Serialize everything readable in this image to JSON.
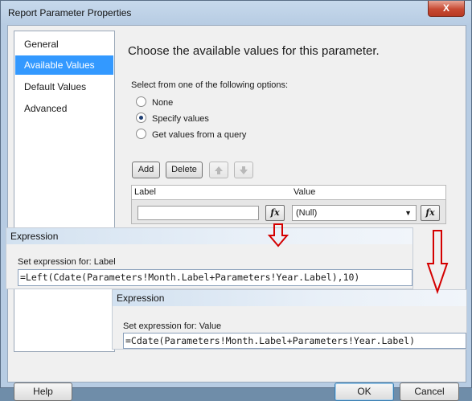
{
  "window": {
    "title": "Report Parameter Properties",
    "close_symbol": "X"
  },
  "nav": {
    "items": [
      "General",
      "Available Values",
      "Default Values",
      "Advanced"
    ],
    "active_index": 1
  },
  "content": {
    "heading": "Choose the available values for this parameter.",
    "options_label": "Select from one of the following options:",
    "options": [
      {
        "label": "None",
        "checked": false
      },
      {
        "label": "Specify values",
        "checked": true
      },
      {
        "label": "Get values from a query",
        "checked": false
      }
    ],
    "buttons": {
      "add": "Add",
      "delete": "Delete",
      "move_up_icon": "arrow-up-icon",
      "move_down_icon": "arrow-down-icon"
    },
    "grid": {
      "columns": [
        "Label",
        "Value"
      ],
      "row": {
        "label_value": "",
        "value_selected": "(Null)"
      },
      "fx_symbol": "fx"
    }
  },
  "expression_label": {
    "title": "Expression",
    "caption": "Set expression for: Label",
    "expression": "=Left(Cdate(Parameters!Month.Label+Parameters!Year.Label),10)"
  },
  "expression_value": {
    "title": "Expression",
    "caption": "Set expression for: Value",
    "expression": "=Cdate(Parameters!Month.Label+Parameters!Year.Label)"
  },
  "footer": {
    "help": "Help",
    "ok": "OK",
    "cancel": "Cancel"
  },
  "colors": {
    "arrow": "#d40000",
    "nav_active": "#3399ff"
  }
}
